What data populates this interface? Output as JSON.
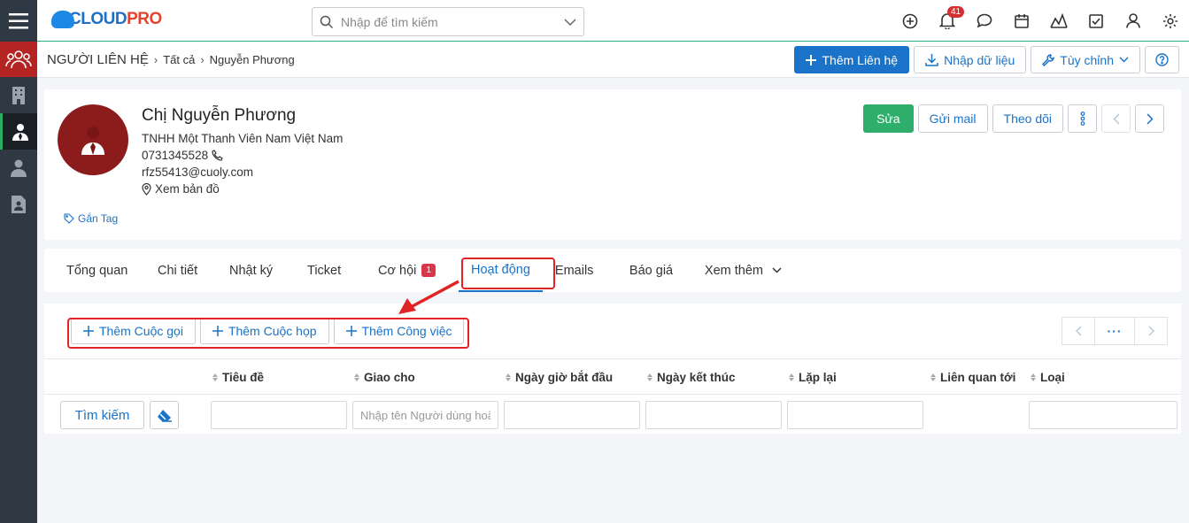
{
  "header": {
    "logo_brand": "CLOUD",
    "logo_brand_accent": "PRO",
    "search_placeholder": "Nhập để tìm kiếm",
    "notification_count": "41"
  },
  "breadcrumb": {
    "module": "NGƯỜI LIÊN HỆ",
    "list": "Tất cả",
    "record": "Nguyễn Phương"
  },
  "toolbar": {
    "add_contact": "Thêm Liên hệ",
    "import": "Nhập dữ liệu",
    "customize": "Tùy chỉnh"
  },
  "contact": {
    "name": "Chị Nguyễn Phương",
    "company": "TNHH Một Thanh Viên Nam Việt Nam",
    "phone": "0731345528",
    "email": "rfz55413@cuoly.com",
    "map": "Xem bản đồ",
    "tag": "Gắn Tag"
  },
  "card_actions": {
    "edit": "Sửa",
    "send_mail": "Gửi mail",
    "follow": "Theo dõi"
  },
  "tabs": [
    {
      "label": "Tổng quan"
    },
    {
      "label": "Chi tiết"
    },
    {
      "label": "Nhật ký"
    },
    {
      "label": "Ticket"
    },
    {
      "label": "Cơ hội",
      "badge": "1"
    },
    {
      "label": "Hoạt động",
      "active": true
    },
    {
      "label": "Emails"
    },
    {
      "label": "Báo giá"
    },
    {
      "label": "Xem thêm"
    }
  ],
  "activity": {
    "add_call": "Thêm Cuộc gọi",
    "add_meeting": "Thêm Cuộc họp",
    "add_task": "Thêm Công việc",
    "pager_more": "···"
  },
  "table": {
    "columns": [
      "Tiêu đề",
      "Giao cho",
      "Ngày giờ bắt đầu",
      "Ngày kết thúc",
      "Lặp lại",
      "Liên quan tới",
      "Loại"
    ],
    "search_button": "Tìm kiếm",
    "assignee_placeholder": "Nhập tên Người dùng hoặc nhóm"
  },
  "colors": {
    "primary": "#1a73c8",
    "success": "#2fae6b",
    "sidebar": "#2f3944",
    "highlight": "#e02424"
  }
}
